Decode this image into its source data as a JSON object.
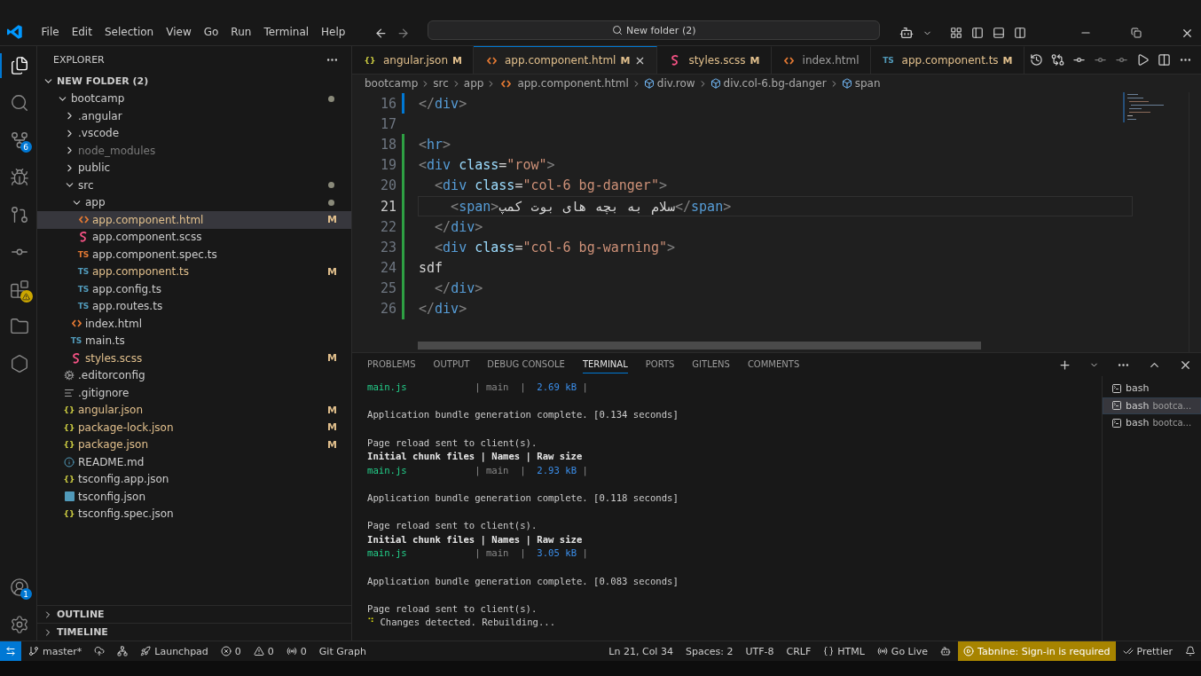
{
  "titlebar": {
    "menu": [
      "File",
      "Edit",
      "Selection",
      "View",
      "Go",
      "Run",
      "Terminal",
      "Help"
    ],
    "command_center": "New folder (2)"
  },
  "activity_bar": {
    "top": [
      {
        "kind": "files",
        "selected": true
      },
      {
        "kind": "search",
        "selected": false
      },
      {
        "kind": "source-control",
        "selected": false,
        "badge": "6"
      },
      {
        "kind": "run-debug",
        "selected": false
      },
      {
        "kind": "gitlens",
        "selected": false
      },
      {
        "kind": "gitlens-inspect",
        "selected": false
      },
      {
        "kind": "extensions",
        "selected": false,
        "warning": true
      },
      {
        "kind": "folder",
        "selected": false
      },
      {
        "kind": "cube",
        "selected": false
      }
    ],
    "bottom": [
      {
        "kind": "account",
        "selected": false,
        "badge": "1"
      },
      {
        "kind": "settings",
        "selected": false
      }
    ]
  },
  "sidebar": {
    "title": "EXPLORER",
    "root": {
      "name": "NEW FOLDER (2)",
      "expanded": true,
      "children": [
        {
          "name": "bootcamp",
          "kind": "folder",
          "expanded": true,
          "dot": true,
          "selected": false,
          "children": [
            {
              "name": ".angular",
              "kind": "folder",
              "expanded": false,
              "selected": false
            },
            {
              "name": ".vscode",
              "kind": "folder",
              "expanded": false,
              "selected": false
            },
            {
              "name": "node_modules",
              "kind": "folder",
              "expanded": false,
              "selected": false,
              "ignored": true
            },
            {
              "name": "public",
              "kind": "folder",
              "expanded": false,
              "selected": false
            },
            {
              "name": "src",
              "kind": "folder",
              "expanded": true,
              "dot": true,
              "selected": false,
              "children": [
                {
                  "name": "app",
                  "kind": "folder",
                  "expanded": true,
                  "dot": true,
                  "selected": false,
                  "children": [
                    {
                      "name": "app.component.html",
                      "kind": "html",
                      "status": "M",
                      "selected": true
                    },
                    {
                      "name": "app.component.scss",
                      "kind": "scss",
                      "selected": false
                    },
                    {
                      "name": "app.component.spec.ts",
                      "kind": "test",
                      "glyph": "TS",
                      "selected": false
                    },
                    {
                      "name": "app.component.ts",
                      "kind": "ts",
                      "glyph": "TS",
                      "status": "M",
                      "selected": false
                    },
                    {
                      "name": "app.config.ts",
                      "kind": "ts",
                      "glyph": "TS",
                      "selected": false
                    },
                    {
                      "name": "app.routes.ts",
                      "kind": "ts",
                      "glyph": "TS",
                      "selected": false
                    }
                  ]
                },
                {
                  "name": "index.html",
                  "kind": "html",
                  "selected": false
                },
                {
                  "name": "main.ts",
                  "kind": "ts",
                  "glyph": "TS",
                  "selected": false
                },
                {
                  "name": "styles.scss",
                  "kind": "scss",
                  "status": "M",
                  "selected": false
                }
              ]
            },
            {
              "name": ".editorconfig",
              "kind": "gear",
              "selected": false
            },
            {
              "name": ".gitignore",
              "kind": "lines",
              "selected": false
            },
            {
              "name": "angular.json",
              "kind": "json",
              "glyph": "{}",
              "status": "M",
              "selected": false
            },
            {
              "name": "package-lock.json",
              "kind": "json",
              "glyph": "{}",
              "status": "M",
              "selected": false
            },
            {
              "name": "package.json",
              "kind": "json",
              "glyph": "{}",
              "status": "M",
              "selected": false
            },
            {
              "name": "README.md",
              "kind": "info",
              "selected": false
            },
            {
              "name": "tsconfig.app.json",
              "kind": "json",
              "glyph": "{}",
              "selected": false
            },
            {
              "name": "tsconfig.json",
              "kind": "tsconfig",
              "selected": false
            },
            {
              "name": "tsconfig.spec.json",
              "kind": "json",
              "glyph": "{}",
              "selected": false
            }
          ]
        }
      ]
    },
    "sections": [
      {
        "name": "OUTLINE",
        "expanded": false
      },
      {
        "name": "TIMELINE",
        "expanded": false
      }
    ]
  },
  "tabs": [
    {
      "label": "angular.json",
      "kind": "json",
      "glyph": "{}",
      "status": "M",
      "selected": false
    },
    {
      "label": "app.component.html",
      "kind": "html",
      "status": "M",
      "selected": true
    },
    {
      "label": "styles.scss",
      "kind": "scss",
      "status": "M",
      "selected": false
    },
    {
      "label": "index.html",
      "kind": "html",
      "selected": false
    },
    {
      "label": "app.component.ts",
      "kind": "ts",
      "glyph": "TS",
      "status": "M",
      "selected": false
    }
  ],
  "breadcrumb": [
    {
      "text": "bootcamp",
      "kind": "folder"
    },
    {
      "text": "src",
      "kind": "folder"
    },
    {
      "text": "app",
      "kind": "folder"
    },
    {
      "text": "app.component.html",
      "kind": "html"
    },
    {
      "text": "div.row",
      "kind": "element"
    },
    {
      "text": "div.col-6.bg-danger",
      "kind": "element"
    },
    {
      "text": "span",
      "kind": "element"
    }
  ],
  "code": [
    {
      "number": "16",
      "kind": "modified",
      "current": false,
      "tokens": [
        {
          "text": "</",
          "kind": "punct"
        },
        {
          "text": "div",
          "kind": "tag"
        },
        {
          "text": ">",
          "kind": "punct"
        }
      ]
    },
    {
      "number": "17",
      "kind": "plain",
      "current": false
    },
    {
      "number": "18",
      "kind": "added",
      "current": false,
      "tokens": [
        {
          "text": "<",
          "kind": "punct"
        },
        {
          "text": "hr",
          "kind": "tag"
        },
        {
          "text": ">",
          "kind": "punct"
        }
      ]
    },
    {
      "number": "19",
      "kind": "added",
      "current": false,
      "tokens": [
        {
          "text": "<",
          "kind": "punct"
        },
        {
          "text": "div",
          "kind": "tag"
        },
        {
          "text": " class",
          "kind": "attr"
        },
        {
          "text": "=",
          "kind": "text"
        },
        {
          "text": "\"row\"",
          "kind": "str"
        },
        {
          "text": ">",
          "kind": "punct"
        }
      ]
    },
    {
      "number": "20",
      "kind": "added",
      "current": false,
      "tokens": [
        {
          "text": "  <",
          "kind": "punct"
        },
        {
          "text": "div",
          "kind": "tag"
        },
        {
          "text": " class",
          "kind": "attr"
        },
        {
          "text": "=",
          "kind": "text"
        },
        {
          "text": "\"col-6 bg-danger\"",
          "kind": "str"
        },
        {
          "text": ">",
          "kind": "punct"
        }
      ]
    },
    {
      "number": "21",
      "kind": "added",
      "current": true,
      "tokens": [
        {
          "text": "    <",
          "kind": "punct"
        },
        {
          "text": "span",
          "kind": "tag"
        },
        {
          "text": ">",
          "kind": "punct"
        },
        {
          "text": "سلام به بچه های بوت کمپ",
          "kind": "text"
        },
        {
          "text": "</",
          "kind": "punct"
        },
        {
          "text": "span",
          "kind": "tag"
        },
        {
          "text": ">",
          "kind": "punct"
        }
      ]
    },
    {
      "number": "22",
      "kind": "added",
      "current": false,
      "tokens": [
        {
          "text": "  </",
          "kind": "punct"
        },
        {
          "text": "div",
          "kind": "tag"
        },
        {
          "text": ">",
          "kind": "punct"
        }
      ]
    },
    {
      "number": "23",
      "kind": "added",
      "current": false,
      "tokens": [
        {
          "text": "  <",
          "kind": "punct"
        },
        {
          "text": "div",
          "kind": "tag"
        },
        {
          "text": " class",
          "kind": "attr"
        },
        {
          "text": "=",
          "kind": "text"
        },
        {
          "text": "\"col-6 bg-warning\"",
          "kind": "str"
        },
        {
          "text": ">",
          "kind": "punct"
        }
      ]
    },
    {
      "number": "24",
      "kind": "added",
      "current": false,
      "tokens": [
        {
          "text": "sdf",
          "kind": "text"
        }
      ]
    },
    {
      "number": "25",
      "kind": "added",
      "current": false,
      "tokens": [
        {
          "text": "  </",
          "kind": "punct"
        },
        {
          "text": "div",
          "kind": "tag"
        },
        {
          "text": ">",
          "kind": "punct"
        }
      ]
    },
    {
      "number": "26",
      "kind": "added",
      "current": false,
      "tokens": [
        {
          "text": "</",
          "kind": "punct"
        },
        {
          "text": "div",
          "kind": "tag"
        },
        {
          "text": ">",
          "kind": "punct"
        }
      ]
    }
  ],
  "panel": {
    "tabs": [
      {
        "label": "PROBLEMS",
        "selected": false
      },
      {
        "label": "OUTPUT",
        "selected": false
      },
      {
        "label": "DEBUG CONSOLE",
        "selected": false
      },
      {
        "label": "TERMINAL",
        "selected": true
      },
      {
        "label": "PORTS",
        "selected": false
      },
      {
        "label": "GITLENS",
        "selected": false
      },
      {
        "label": "COMMENTS",
        "selected": false
      }
    ],
    "terminal": [
      {
        "kind": "text",
        "segments": [
          {
            "text": "main.js",
            "kind": "green"
          },
          {
            "text": "            | main  |  ",
            "kind": "dim"
          },
          {
            "text": "2.69 kB",
            "kind": "blue"
          },
          {
            "text": " |",
            "kind": "dim"
          }
        ]
      },
      {
        "kind": "blank"
      },
      {
        "kind": "text",
        "segments": [
          {
            "text": "Application bundle generation complete. [0.134 seconds]",
            "kind": "plain"
          }
        ]
      },
      {
        "kind": "blank"
      },
      {
        "kind": "text",
        "segments": [
          {
            "text": "Page reload sent to client(s).",
            "kind": "plain"
          }
        ]
      },
      {
        "kind": "text",
        "segments": [
          {
            "text": "Initial chunk files | Names | Raw size",
            "kind": "bold"
          }
        ]
      },
      {
        "kind": "text",
        "segments": [
          {
            "text": "main.js",
            "kind": "green"
          },
          {
            "text": "            | main  |  ",
            "kind": "dim"
          },
          {
            "text": "2.93 kB",
            "kind": "blue"
          },
          {
            "text": " |",
            "kind": "dim"
          }
        ]
      },
      {
        "kind": "blank"
      },
      {
        "kind": "text",
        "segments": [
          {
            "text": "Application bundle generation complete. [0.118 seconds]",
            "kind": "plain"
          }
        ]
      },
      {
        "kind": "blank"
      },
      {
        "kind": "text",
        "segments": [
          {
            "text": "Page reload sent to client(s).",
            "kind": "plain"
          }
        ]
      },
      {
        "kind": "text",
        "segments": [
          {
            "text": "Initial chunk files | Names | Raw size",
            "kind": "bold"
          }
        ]
      },
      {
        "kind": "text",
        "segments": [
          {
            "text": "main.js",
            "kind": "green"
          },
          {
            "text": "            | main  |  ",
            "kind": "dim"
          },
          {
            "text": "3.05 kB",
            "kind": "blue"
          },
          {
            "text": " |",
            "kind": "dim"
          }
        ]
      },
      {
        "kind": "blank"
      },
      {
        "kind": "text",
        "segments": [
          {
            "text": "Application bundle generation complete. [0.083 seconds]",
            "kind": "plain"
          }
        ]
      },
      {
        "kind": "blank"
      },
      {
        "kind": "text",
        "segments": [
          {
            "text": "Page reload sent to client(s).",
            "kind": "plain"
          }
        ]
      },
      {
        "kind": "text",
        "segments": [
          {
            "text": "⠙",
            "kind": "spinner"
          },
          {
            "text": " Changes detected. Rebuilding...",
            "kind": "plain"
          }
        ]
      }
    ],
    "terminals": [
      {
        "name": "bash",
        "selected": false
      },
      {
        "name": "bash",
        "detail": "bootca...",
        "selected": true
      },
      {
        "name": "bash",
        "detail": "bootca...",
        "selected": false
      }
    ]
  },
  "status_bar": {
    "left": [
      {
        "kind": "remote"
      },
      {
        "kind": "branch",
        "text": "master*"
      },
      {
        "kind": "cloud-sync"
      },
      {
        "kind": "graph"
      },
      {
        "kind": "rocket",
        "text": "Launchpad"
      },
      {
        "kind": "error",
        "text": "0"
      },
      {
        "kind": "warning",
        "text": "0"
      },
      {
        "kind": "ports",
        "text": "0"
      },
      {
        "kind": "plain",
        "text": "Git Graph"
      }
    ],
    "right": [
      {
        "kind": "plain",
        "text": "Ln 21, Col 34"
      },
      {
        "kind": "plain",
        "text": "Spaces: 2"
      },
      {
        "kind": "plain",
        "text": "UTF-8"
      },
      {
        "kind": "plain",
        "text": "CRLF"
      },
      {
        "kind": "braces",
        "text": "HTML"
      },
      {
        "kind": "radio",
        "text": "Go Live"
      },
      {
        "kind": "copilot"
      },
      {
        "kind": "tabnine",
        "text": "Tabnine: Sign-in is required"
      },
      {
        "kind": "prettier",
        "text": "Prettier"
      },
      {
        "kind": "bell"
      }
    ]
  }
}
